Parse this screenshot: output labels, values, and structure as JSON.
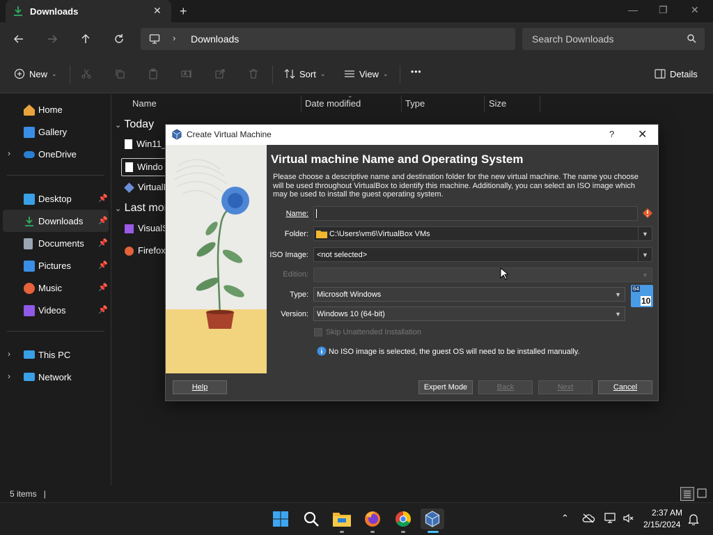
{
  "window": {
    "tab_title": "Downloads",
    "new_tab": "+",
    "minimize": "—",
    "maximize": "❐",
    "close": "✕"
  },
  "nav": {
    "breadcrumb": "Downloads",
    "search_placeholder": "Search Downloads"
  },
  "command_bar": {
    "new_label": "New",
    "sort_label": "Sort",
    "view_label": "View",
    "more_label": "•••",
    "details_label": "Details"
  },
  "sidebar": {
    "items": [
      {
        "label": "Home",
        "color": "#e8a33d"
      },
      {
        "label": "Gallery",
        "color": "#3a8ee6"
      },
      {
        "label": "OneDrive",
        "color": "#2a7fd4"
      },
      {
        "label": "Desktop",
        "color": "#3aa0e6"
      },
      {
        "label": "Downloads",
        "color": "#2fae5f"
      },
      {
        "label": "Documents",
        "color": "#9aa4b2"
      },
      {
        "label": "Pictures",
        "color": "#3a8ee6"
      },
      {
        "label": "Music",
        "color": "#e5623a"
      },
      {
        "label": "Videos",
        "color": "#8e5ae6"
      },
      {
        "label": "This PC",
        "color": "#3aa0e6"
      },
      {
        "label": "Network",
        "color": "#3aa0e6"
      }
    ]
  },
  "file_list": {
    "columns": [
      "Name",
      "Date modified",
      "Type",
      "Size"
    ],
    "groups": [
      {
        "label": "Today",
        "files": [
          "Win11_",
          "Windo",
          "VirtualB"
        ]
      },
      {
        "label": "Last mon",
        "files": [
          "VisualS",
          "Firefox"
        ]
      }
    ]
  },
  "status": {
    "items": "5 items",
    "cursor": "|"
  },
  "dialog": {
    "title": "Create Virtual Machine",
    "help_glyph": "?",
    "close_glyph": "✕",
    "heading": "Virtual machine Name and Operating System",
    "description": "Please choose a descriptive name and destination folder for the new virtual machine. The name you choose will be used throughout VirtualBox to identify this machine. Additionally, you can select an ISO image which may be used to install the guest operating system.",
    "labels": {
      "name": "Name:",
      "folder": "Folder:",
      "iso": "ISO Image:",
      "edition": "Edition:",
      "type": "Type:",
      "version": "Version:"
    },
    "name_value": "",
    "folder_value": "C:\\Users\\vm6\\VirtualBox VMs",
    "iso_value": "<not selected>",
    "edition_value": "",
    "type_value": "Microsoft Windows",
    "version_value": "Windows 10 (64-bit)",
    "badge_top": "64",
    "badge_bottom": "10",
    "skip_unattended": "Skip Unattended Installation",
    "info_message": "No ISO image is selected, the guest OS will need to be installed manually.",
    "buttons": {
      "help": "Help",
      "expert": "Expert Mode",
      "back": "Back",
      "next": "Next",
      "cancel": "Cancel"
    }
  },
  "taskbar": {
    "time": "2:37 AM",
    "date": "2/15/2024"
  }
}
